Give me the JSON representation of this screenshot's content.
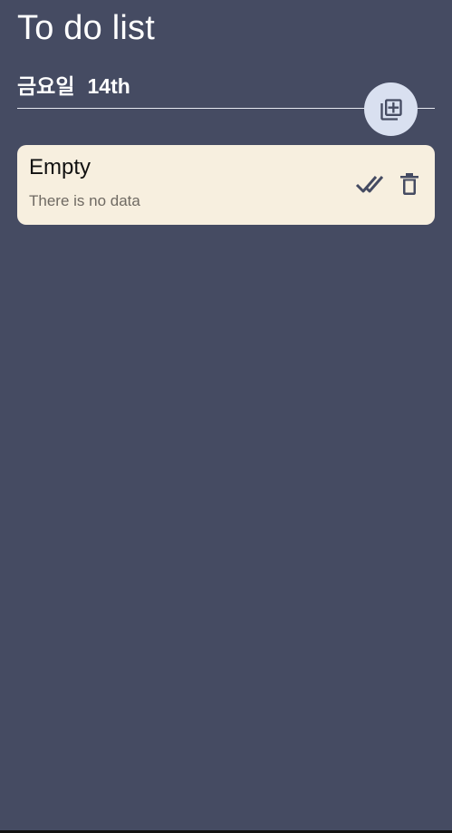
{
  "header": {
    "title": "To do list",
    "day_of_week": "금요일",
    "day": "14th"
  },
  "add_button": {
    "icon": "add-to-library-icon"
  },
  "todo_items": [
    {
      "title": "Empty",
      "description": "There is no data",
      "actions": [
        "done-check-icon",
        "trash-icon"
      ]
    }
  ],
  "colors": {
    "background": "#454b62",
    "card_background": "#f7efdf",
    "button_background": "#d9e0f0",
    "icon_color": "#454b62",
    "text_primary": "#ffffff"
  }
}
